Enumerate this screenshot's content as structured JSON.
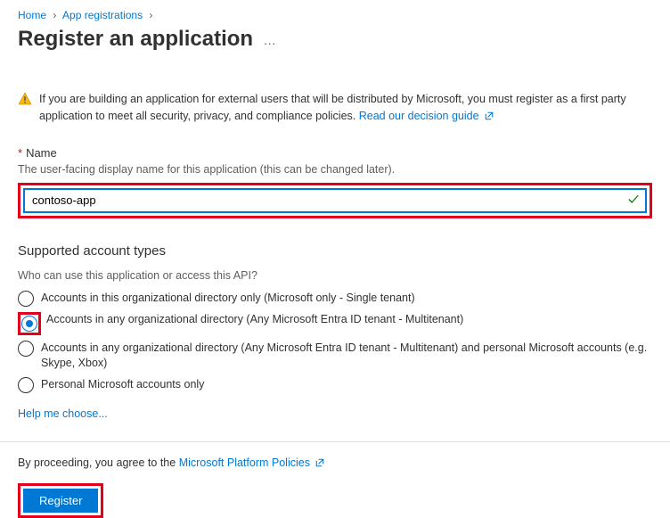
{
  "breadcrumb": {
    "home": "Home",
    "app_reg": "App registrations"
  },
  "page_title": "Register an application",
  "warning": {
    "text": "If you are building an application for external users that will be distributed by Microsoft, you must register as a first party application to meet all security, privacy, and compliance policies. ",
    "link_text": "Read our decision guide"
  },
  "name_field": {
    "label": "Name",
    "description": "The user-facing display name for this application (this can be changed later).",
    "value": "contoso-app"
  },
  "account_types": {
    "heading": "Supported account types",
    "question": "Who can use this application or access this API?",
    "options": [
      "Accounts in this organizational directory only (Microsoft only - Single tenant)",
      "Accounts in any organizational directory (Any Microsoft Entra ID tenant - Multitenant)",
      "Accounts in any organizational directory (Any Microsoft Entra ID tenant - Multitenant) and personal Microsoft accounts (e.g. Skype, Xbox)",
      "Personal Microsoft accounts only"
    ],
    "help_link": "Help me choose..."
  },
  "footer": {
    "agree_prefix": "By proceeding, you agree to the ",
    "policy_link": "Microsoft Platform Policies",
    "register_btn": "Register"
  }
}
